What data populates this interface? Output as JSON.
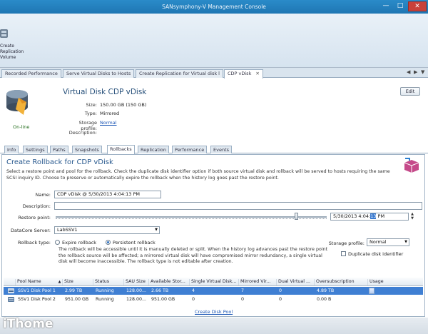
{
  "window": {
    "title": "SANsymphony-V Management Console"
  },
  "ribbon": {
    "button_label": "Create\nReplication\nVolume"
  },
  "doc_tabs": [
    {
      "label": "Recorded Performance"
    },
    {
      "label": "Serve Virtual Disks to Hosts"
    },
    {
      "label": "Create Replication for Virtual disk l"
    },
    {
      "label": "CDP vDisk"
    }
  ],
  "disk": {
    "status": "On-line",
    "title": "Virtual Disk CDP vDisk",
    "size_label": "Size:",
    "size": "150.00 GB (150 GB)",
    "type_label": "Type:",
    "type": "Mirrored",
    "profile_label": "Storage profile:",
    "profile": "Normal",
    "desc_label": "Description:",
    "edit": "Edit"
  },
  "sub_tabs": [
    "Info",
    "Settings",
    "Paths",
    "Snapshots",
    "Rollbacks",
    "Replication",
    "Performance",
    "Events"
  ],
  "rollback": {
    "title": "Create Rollback for CDP vDisk",
    "description": "Select a restore point and pool for the rollback. Check the duplicate disk identifier option if both source virtual disk and rollback will be served to hosts requiring the same SCSI inquiry ID. Choose to preserve or automatically expire the rollback when the history log goes past the restore point.",
    "name_label": "Name:",
    "name_value": "CDP vDisk @ 5/30/2013 4:04:13 PM",
    "desc_label": "Description:",
    "desc_value": "",
    "restore_label": "Restore point:",
    "restore_position": 0.89,
    "time_prefix": "5/30/2013  4:04:",
    "time_sel": "13",
    "time_suffix": " PM",
    "server_label": "DataCore Server:",
    "server_value": "LabSSV1",
    "type_label": "Rollback type:",
    "expire_label": "Expire rollback",
    "persistent_label": "Persistent rollback",
    "profile_label": "Storage profile:",
    "profile_value": "Normal",
    "dup_label": "Duplicate disk identifier",
    "note": "The rollback will be accessible until it is manually deleted or split. When the history log advances past the restore point the rollback source will be affected; a mirrored virtual disk will have compromised mirror redundancy, a single virtual disk will become inaccessible. The rollback type is not editable after creation."
  },
  "pool_grid": {
    "columns": [
      "Pool Name",
      "Size",
      "Status",
      "SAU Size",
      "Available Stor...",
      "Single Virtual Disk...",
      "Mirrored Vir...",
      "Dual Virtual ...",
      "Oversubscription",
      "Usage"
    ],
    "rows": [
      [
        "SSV1 Disk Pool 1",
        "2.99 TB",
        "Running",
        "128.00...",
        "2.66 TB",
        "4",
        "7",
        "0",
        "4.89 TB",
        ""
      ],
      [
        "SSV1 Disk Pool 2",
        "951.00 GB",
        "Running",
        "128.00...",
        "951.00 GB",
        "0",
        "0",
        "0",
        "0.00 B",
        ""
      ]
    ],
    "create_link": "Create Disk Pool"
  },
  "watermark": "iThome",
  "colors": {
    "titlebar": "#2a8bc9",
    "selection": "#3f7fd3",
    "link": "#1a55b5"
  }
}
